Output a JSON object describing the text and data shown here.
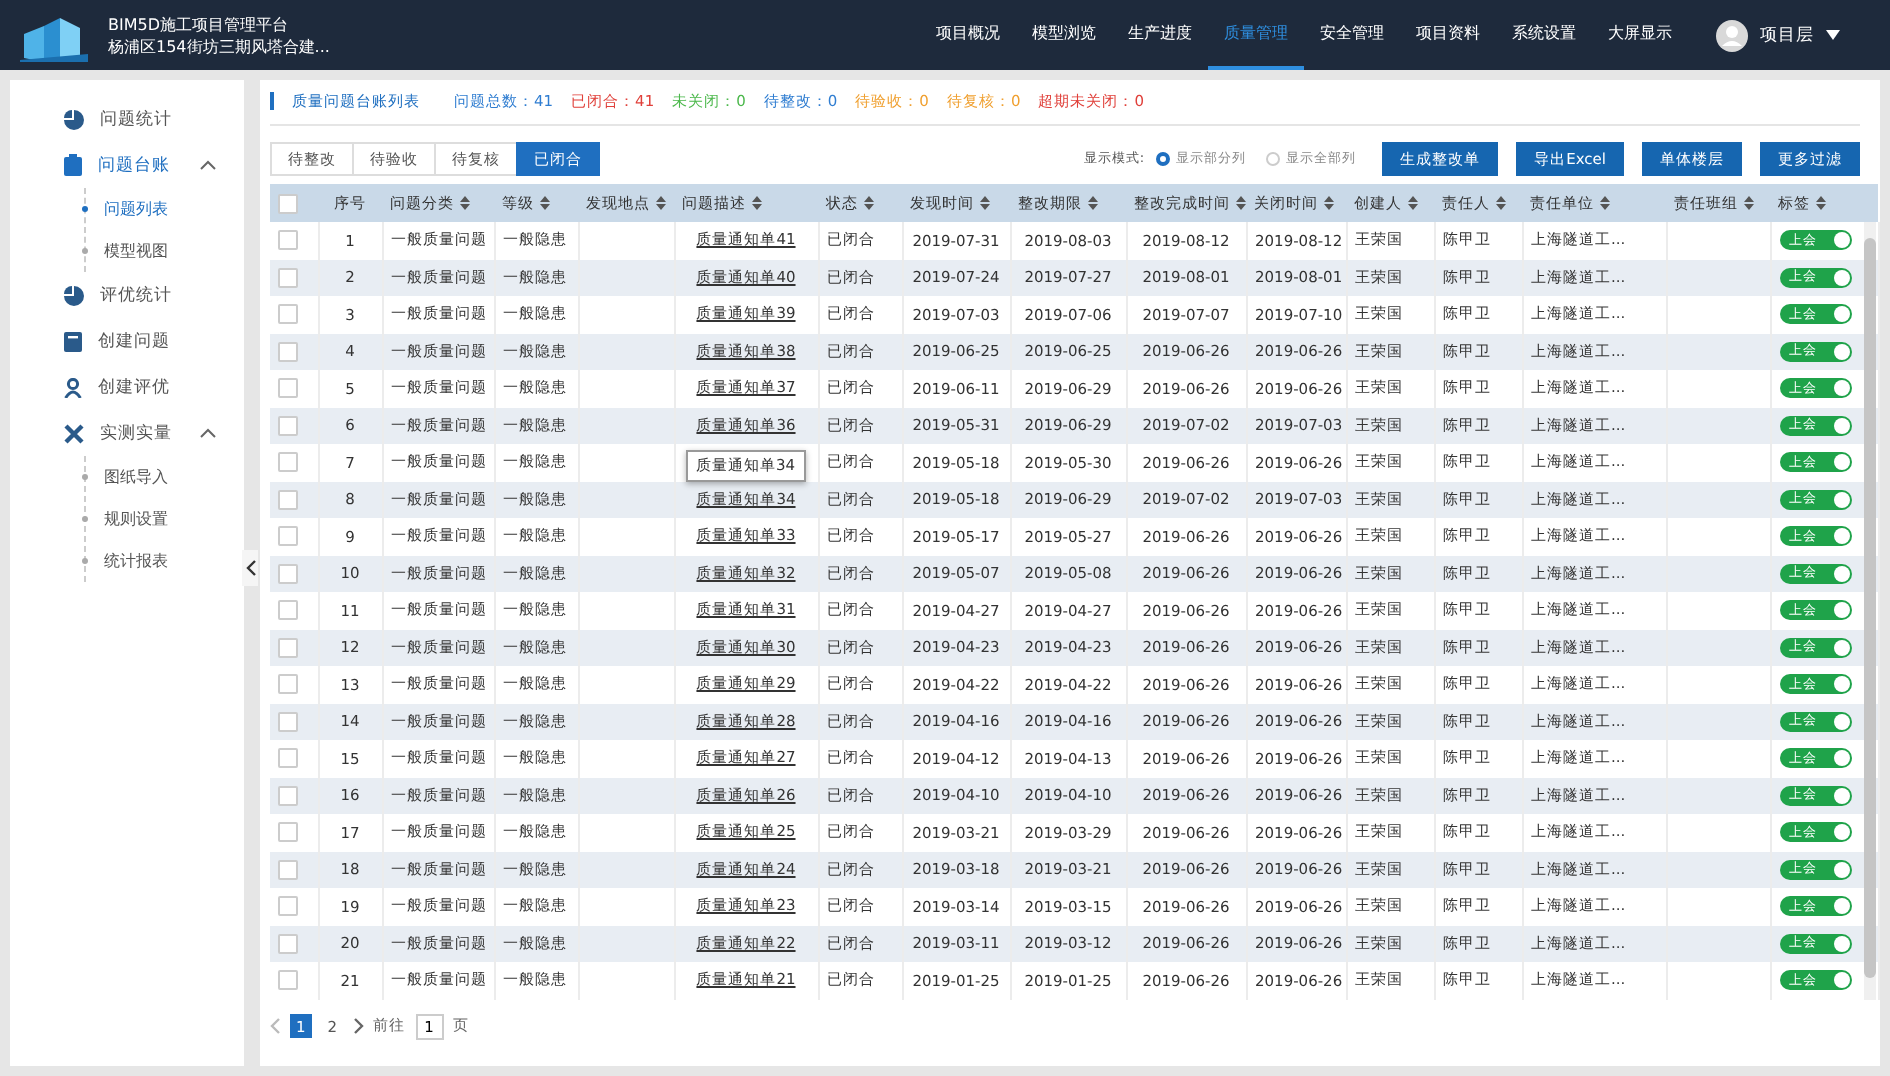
{
  "app": {
    "title": "BIM5D施工项目管理平台",
    "project": "杨浦区154街坊三期风塔合建..."
  },
  "nav": [
    {
      "label": "项目概况",
      "selected": false
    },
    {
      "label": "模型浏览",
      "selected": false
    },
    {
      "label": "生产进度",
      "selected": false
    },
    {
      "label": "质量管理",
      "selected": true
    },
    {
      "label": "安全管理",
      "selected": false
    },
    {
      "label": "项目资料",
      "selected": false
    },
    {
      "label": "系统设置",
      "selected": false
    },
    {
      "label": "大屏显示",
      "selected": false
    }
  ],
  "user": {
    "name": "项目层"
  },
  "sidebar": [
    {
      "label": "问题统计",
      "selected": false
    },
    {
      "label": "问题台账",
      "selected": true,
      "expanded": true,
      "children": [
        {
          "label": "问题列表",
          "selected": true
        },
        {
          "label": "模型视图",
          "selected": false
        }
      ]
    },
    {
      "label": "评优统计",
      "selected": false
    },
    {
      "label": "创建问题",
      "selected": false
    },
    {
      "label": "创建评优",
      "selected": false
    },
    {
      "label": "实测实量",
      "selected": false,
      "expanded": true,
      "children": [
        {
          "label": "图纸导入",
          "selected": false
        },
        {
          "label": "规则设置",
          "selected": false
        },
        {
          "label": "统计报表",
          "selected": false
        }
      ]
    }
  ],
  "panel_title": "质量问题台账列表",
  "stats": [
    {
      "label": "问题总数：",
      "value": "41",
      "color": "#2f7dd1"
    },
    {
      "label": "已闭合：",
      "value": "41",
      "color": "#e0403a"
    },
    {
      "label": "未关闭：",
      "value": "0",
      "color": "#4cb84c"
    },
    {
      "label": "待整改：",
      "value": "0",
      "color": "#2f7dd1"
    },
    {
      "label": "待验收：",
      "value": "0",
      "color": "#f0a030"
    },
    {
      "label": "待复核：",
      "value": "0",
      "color": "#f0a030"
    },
    {
      "label": "超期未关闭：",
      "value": "0",
      "color": "#e0403a"
    }
  ],
  "status_tabs": [
    {
      "label": "待整改",
      "selected": false
    },
    {
      "label": "待验收",
      "selected": false
    },
    {
      "label": "待复核",
      "selected": false
    },
    {
      "label": "已闭合",
      "selected": true
    }
  ],
  "display_mode": {
    "label": "显示模式:",
    "options": [
      {
        "label": "显示部分列",
        "selected": true
      },
      {
        "label": "显示全部列",
        "selected": false
      }
    ]
  },
  "actions": [
    "生成整改单",
    "导出Excel",
    "单体楼层",
    "更多过滤"
  ],
  "table": {
    "header_checked": false,
    "columns": [
      "序号",
      "问题分类",
      "等级",
      "发现地点",
      "问题描述",
      "状态",
      "发现时间",
      "整改期限",
      "整改完成时间",
      "关闭时间",
      "创建人",
      "责任人",
      "责任单位",
      "责任班组",
      "标签"
    ],
    "rows": [
      {
        "checked": false,
        "no": "1",
        "category": "一般质量问题",
        "level": "一般隐患",
        "description": "质量通知单41",
        "status": "已闭合",
        "found": "2019-07-31",
        "deadline": "2019-08-03",
        "done": "2019-08-12",
        "closed": "2019-08-12",
        "creator": "王荣国",
        "owner": "陈甲卫",
        "unit": "上海隧道工...",
        "tag": {
          "label": "上会",
          "on": true
        }
      },
      {
        "checked": false,
        "no": "2",
        "category": "一般质量问题",
        "level": "一般隐患",
        "description": "质量通知单40",
        "status": "已闭合",
        "found": "2019-07-24",
        "deadline": "2019-07-27",
        "done": "2019-08-01",
        "closed": "2019-08-01",
        "creator": "王荣国",
        "owner": "陈甲卫",
        "unit": "上海隧道工...",
        "tag": {
          "label": "上会",
          "on": true
        }
      },
      {
        "checked": false,
        "no": "3",
        "category": "一般质量问题",
        "level": "一般隐患",
        "description": "质量通知单39",
        "status": "已闭合",
        "found": "2019-07-03",
        "deadline": "2019-07-06",
        "done": "2019-07-07",
        "closed": "2019-07-10",
        "creator": "王荣国",
        "owner": "陈甲卫",
        "unit": "上海隧道工...",
        "tag": {
          "label": "上会",
          "on": true
        }
      },
      {
        "checked": false,
        "no": "4",
        "category": "一般质量问题",
        "level": "一般隐患",
        "description": "质量通知单38",
        "status": "已闭合",
        "found": "2019-06-25",
        "deadline": "2019-06-25",
        "done": "2019-06-26",
        "closed": "2019-06-26",
        "creator": "王荣国",
        "owner": "陈甲卫",
        "unit": "上海隧道工...",
        "tag": {
          "label": "上会",
          "on": true
        }
      },
      {
        "checked": false,
        "no": "5",
        "category": "一般质量问题",
        "level": "一般隐患",
        "description": "质量通知单37",
        "status": "已闭合",
        "found": "2019-06-11",
        "deadline": "2019-06-29",
        "done": "2019-06-26",
        "closed": "2019-06-26",
        "creator": "王荣国",
        "owner": "陈甲卫",
        "unit": "上海隧道工...",
        "tag": {
          "label": "上会",
          "on": true
        }
      },
      {
        "checked": false,
        "no": "6",
        "category": "一般质量问题",
        "level": "一般隐患",
        "description": "质量通知单36",
        "status": "已闭合",
        "found": "2019-05-31",
        "deadline": "2019-06-29",
        "done": "2019-07-02",
        "closed": "2019-07-03",
        "creator": "王荣国",
        "owner": "陈甲卫",
        "unit": "上海隧道工...",
        "tag": {
          "label": "上会",
          "on": true
        }
      },
      {
        "checked": false,
        "no": "7",
        "category": "一般质量问题",
        "level": "一般隐患",
        "tooltip": "质量通知单34",
        "status": "已闭合",
        "found": "2019-05-18",
        "deadline": "2019-05-30",
        "done": "2019-06-26",
        "closed": "2019-06-26",
        "creator": "王荣国",
        "owner": "陈甲卫",
        "unit": "上海隧道工...",
        "tag": {
          "label": "上会",
          "on": true
        }
      },
      {
        "checked": false,
        "no": "8",
        "category": "一般质量问题",
        "level": "一般隐患",
        "description": "质量通知单34",
        "status": "已闭合",
        "found": "2019-05-18",
        "deadline": "2019-06-29",
        "done": "2019-07-02",
        "closed": "2019-07-03",
        "creator": "王荣国",
        "owner": "陈甲卫",
        "unit": "上海隧道工...",
        "tag": {
          "label": "上会",
          "on": true
        }
      },
      {
        "checked": false,
        "no": "9",
        "category": "一般质量问题",
        "level": "一般隐患",
        "description": "质量通知单33",
        "status": "已闭合",
        "found": "2019-05-17",
        "deadline": "2019-05-27",
        "done": "2019-06-26",
        "closed": "2019-06-26",
        "creator": "王荣国",
        "owner": "陈甲卫",
        "unit": "上海隧道工...",
        "tag": {
          "label": "上会",
          "on": true
        }
      },
      {
        "checked": false,
        "no": "10",
        "category": "一般质量问题",
        "level": "一般隐患",
        "description": "质量通知单32",
        "status": "已闭合",
        "found": "2019-05-07",
        "deadline": "2019-05-08",
        "done": "2019-06-26",
        "closed": "2019-06-26",
        "creator": "王荣国",
        "owner": "陈甲卫",
        "unit": "上海隧道工...",
        "tag": {
          "label": "上会",
          "on": true
        }
      },
      {
        "checked": false,
        "no": "11",
        "category": "一般质量问题",
        "level": "一般隐患",
        "description": "质量通知单31",
        "status": "已闭合",
        "found": "2019-04-27",
        "deadline": "2019-04-27",
        "done": "2019-06-26",
        "closed": "2019-06-26",
        "creator": "王荣国",
        "owner": "陈甲卫",
        "unit": "上海隧道工...",
        "tag": {
          "label": "上会",
          "on": true
        }
      },
      {
        "checked": false,
        "no": "12",
        "category": "一般质量问题",
        "level": "一般隐患",
        "description": "质量通知单30",
        "status": "已闭合",
        "found": "2019-04-23",
        "deadline": "2019-04-23",
        "done": "2019-06-26",
        "closed": "2019-06-26",
        "creator": "王荣国",
        "owner": "陈甲卫",
        "unit": "上海隧道工...",
        "tag": {
          "label": "上会",
          "on": true
        }
      },
      {
        "checked": false,
        "no": "13",
        "category": "一般质量问题",
        "level": "一般隐患",
        "description": "质量通知单29",
        "status": "已闭合",
        "found": "2019-04-22",
        "deadline": "2019-04-22",
        "done": "2019-06-26",
        "closed": "2019-06-26",
        "creator": "王荣国",
        "owner": "陈甲卫",
        "unit": "上海隧道工...",
        "tag": {
          "label": "上会",
          "on": true
        }
      },
      {
        "checked": false,
        "no": "14",
        "category": "一般质量问题",
        "level": "一般隐患",
        "description": "质量通知单28",
        "status": "已闭合",
        "found": "2019-04-16",
        "deadline": "2019-04-16",
        "done": "2019-06-26",
        "closed": "2019-06-26",
        "creator": "王荣国",
        "owner": "陈甲卫",
        "unit": "上海隧道工...",
        "tag": {
          "label": "上会",
          "on": true
        }
      },
      {
        "checked": false,
        "no": "15",
        "category": "一般质量问题",
        "level": "一般隐患",
        "description": "质量通知单27",
        "status": "已闭合",
        "found": "2019-04-12",
        "deadline": "2019-04-13",
        "done": "2019-06-26",
        "closed": "2019-06-26",
        "creator": "王荣国",
        "owner": "陈甲卫",
        "unit": "上海隧道工...",
        "tag": {
          "label": "上会",
          "on": true
        }
      },
      {
        "checked": false,
        "no": "16",
        "category": "一般质量问题",
        "level": "一般隐患",
        "description": "质量通知单26",
        "status": "已闭合",
        "found": "2019-04-10",
        "deadline": "2019-04-10",
        "done": "2019-06-26",
        "closed": "2019-06-26",
        "creator": "王荣国",
        "owner": "陈甲卫",
        "unit": "上海隧道工...",
        "tag": {
          "label": "上会",
          "on": true
        }
      },
      {
        "checked": false,
        "no": "17",
        "category": "一般质量问题",
        "level": "一般隐患",
        "description": "质量通知单25",
        "status": "已闭合",
        "found": "2019-03-21",
        "deadline": "2019-03-29",
        "done": "2019-06-26",
        "closed": "2019-06-26",
        "creator": "王荣国",
        "owner": "陈甲卫",
        "unit": "上海隧道工...",
        "tag": {
          "label": "上会",
          "on": true
        }
      },
      {
        "checked": false,
        "no": "18",
        "category": "一般质量问题",
        "level": "一般隐患",
        "description": "质量通知单24",
        "status": "已闭合",
        "found": "2019-03-18",
        "deadline": "2019-03-21",
        "done": "2019-06-26",
        "closed": "2019-06-26",
        "creator": "王荣国",
        "owner": "陈甲卫",
        "unit": "上海隧道工...",
        "tag": {
          "label": "上会",
          "on": true
        }
      },
      {
        "checked": false,
        "no": "19",
        "category": "一般质量问题",
        "level": "一般隐患",
        "description": "质量通知单23",
        "status": "已闭合",
        "found": "2019-03-14",
        "deadline": "2019-03-15",
        "done": "2019-06-26",
        "closed": "2019-06-26",
        "creator": "王荣国",
        "owner": "陈甲卫",
        "unit": "上海隧道工...",
        "tag": {
          "label": "上会",
          "on": true
        }
      },
      {
        "checked": false,
        "no": "20",
        "category": "一般质量问题",
        "level": "一般隐患",
        "description": "质量通知单22",
        "status": "已闭合",
        "found": "2019-03-11",
        "deadline": "2019-03-12",
        "done": "2019-06-26",
        "closed": "2019-06-26",
        "creator": "王荣国",
        "owner": "陈甲卫",
        "unit": "上海隧道工...",
        "tag": {
          "label": "上会",
          "on": true
        }
      },
      {
        "checked": false,
        "no": "21",
        "category": "一般质量问题",
        "level": "一般隐患",
        "description": "质量通知单21",
        "status": "已闭合",
        "found": "2019-01-25",
        "deadline": "2019-01-25",
        "done": "2019-06-26",
        "closed": "2019-06-26",
        "creator": "王荣国",
        "owner": "陈甲卫",
        "unit": "上海隧道工...",
        "tag": {
          "label": "上会",
          "on": true
        }
      }
    ]
  },
  "pagination": {
    "pages": [
      {
        "label": "1",
        "selected": true
      },
      {
        "label": "2",
        "selected": false
      }
    ],
    "goto_label": "前往",
    "page_value": "1",
    "page_suffix": "页"
  }
}
